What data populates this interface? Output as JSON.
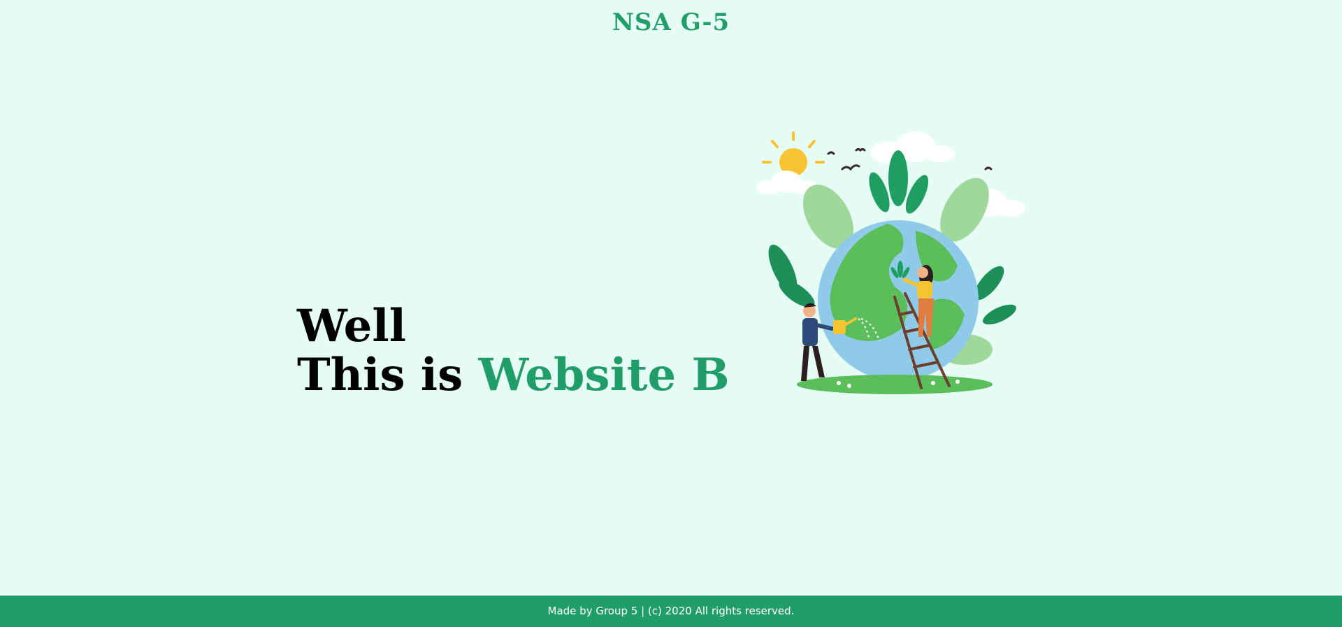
{
  "header": {
    "brand": "NSA G-5"
  },
  "hero": {
    "line1": "Well",
    "line2_prefix": "This is ",
    "line2_accent": "Website B"
  },
  "illustration": {
    "icon": "earth-planting-illustration"
  },
  "footer": {
    "text": "Made by Group 5 | (c) 2020 All rights reserved."
  },
  "colors": {
    "background": "#e6fdf5",
    "accent": "#219d6a",
    "footer_bg": "#219d6a"
  }
}
